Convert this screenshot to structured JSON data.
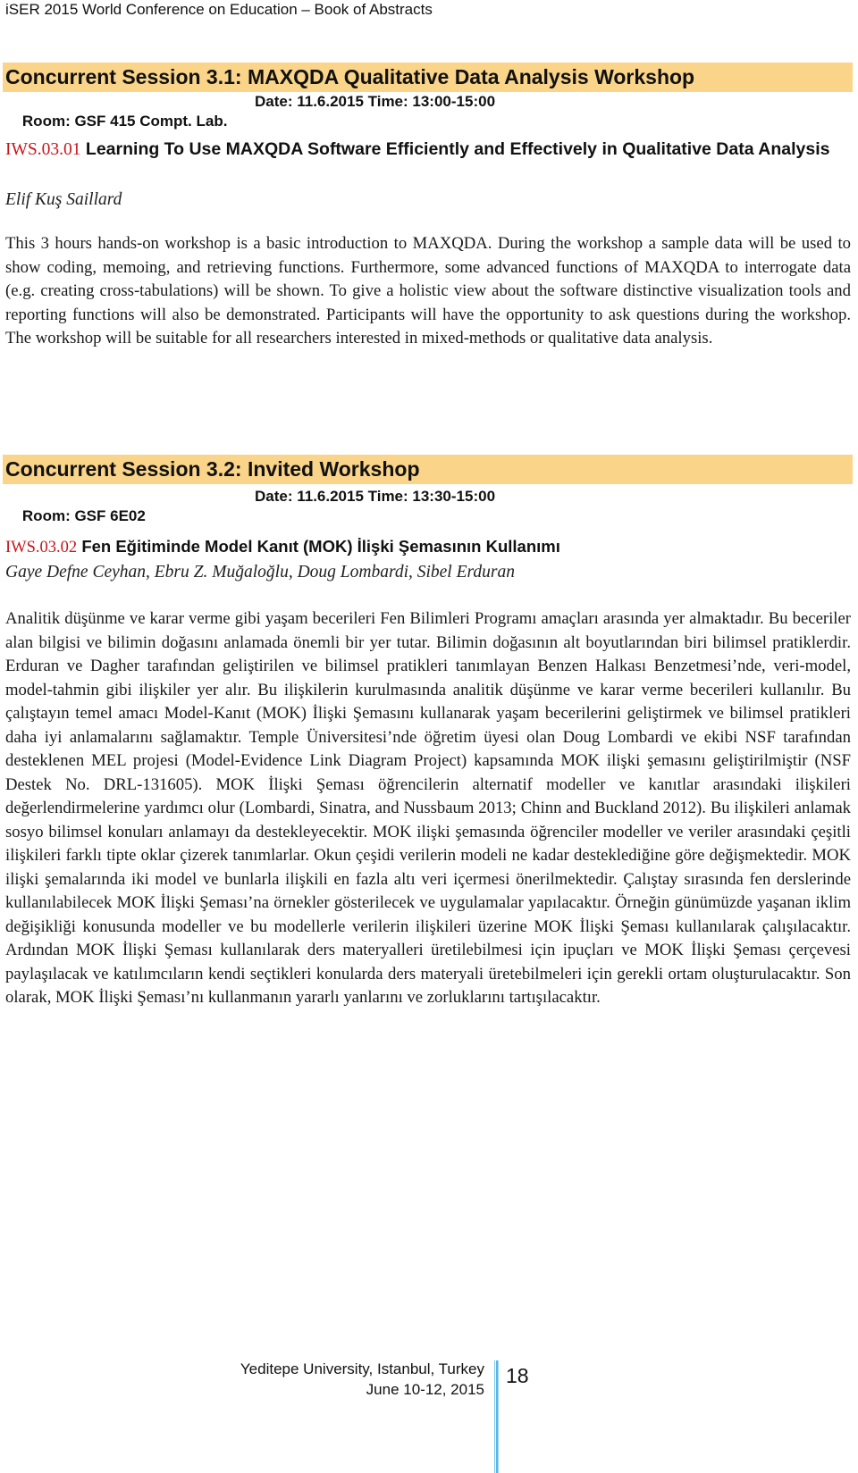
{
  "running_header": "iSER 2015 World Conference on Education – Book of Abstracts",
  "sessions": [
    {
      "title": "Concurrent Session 3.1: MAXQDA Qualitative Data Analysis Workshop",
      "room": "Room: GSF 415 Compt. Lab.",
      "date_time": "Date: 11.6.2015  Time: 13:00-15:00",
      "abstract": {
        "id": "IWS.03.01",
        "title": "Learning To Use MAXQDA Software Efficiently and Effectively in Qualitative Data Analysis",
        "authors": "Elif Kuş Saillard",
        "body": "This 3 hours hands-on workshop is a basic introduction to MAXQDA. During the workshop a sample data will be used to show coding, memoing, and retrieving functions. Furthermore, some advanced functions of MAXQDA to interrogate data (e.g. creating cross-tabulations) will be shown. To give a holistic view about the software distinctive visualization tools and reporting functions will also be demonstrated. Participants will have the opportunity to ask questions during the workshop. The workshop will be suitable for all researchers interested in mixed-methods or qualitative data analysis."
      }
    },
    {
      "title": "Concurrent Session 3.2: Invited Workshop",
      "room": "Room: GSF 6E02",
      "date_time": "Date: 11.6.2015  Time: 13:30-15:00",
      "abstract": {
        "id": "IWS.03.02",
        "title": "Fen Eğitiminde Model Kanıt (MOK) İlişki Şemasının Kullanımı",
        "authors": "Gaye Defne Ceyhan, Ebru Z. Muğaloğlu, Doug Lombardi, Sibel Erduran",
        "body": "Analitik düşünme ve karar verme gibi yaşam becerileri Fen Bilimleri Programı amaçları arasında yer almaktadır. Bu beceriler alan bilgisi ve bilimin doğasını anlamada önemli bir yer tutar. Bilimin doğasının alt boyutlarından biri bilimsel pratiklerdir. Erduran ve Dagher tarafından geliştirilen ve bilimsel pratikleri tanımlayan Benzen Halkası Benzetmesi’nde, veri-model, model-tahmin gibi ilişkiler yer alır. Bu ilişkilerin kurulmasında analitik düşünme ve karar verme becerileri kullanılır. Bu çalıştayın temel amacı Model-Kanıt (MOK) İlişki Şemasını kullanarak yaşam becerilerini geliştirmek ve bilimsel pratikleri daha iyi anlamalarını sağlamaktır. Temple Üniversitesi’nde öğretim üyesi olan Doug Lombardi ve ekibi NSF tarafından desteklenen MEL projesi (Model-Evidence Link Diagram Project) kapsamında MOK ilişki şemasını geliştirilmiştir (NSF Destek No. DRL-131605). MOK İlişki Şeması öğrencilerin alternatif modeller ve kanıtlar arasındaki ilişkileri değerlendirmelerine yardımcı olur (Lombardi, Sinatra, and Nussbaum 2013; Chinn and Buckland 2012). Bu ilişkileri anlamak sosyo bilimsel konuları anlamayı da destekleyecektir. MOK ilişki şemasında öğrenciler modeller ve veriler arasındaki çeşitli ilişkileri farklı tipte oklar çizerek tanımlarlar. Okun çeşidi verilerin modeli ne kadar desteklediğine göre değişmektedir. MOK ilişki şemalarında iki model ve bunlarla ilişkili en fazla altı veri içermesi önerilmektedir. Çalıştay sırasında fen derslerinde kullanılabilecek MOK İlişki Şeması’na örnekler gösterilecek ve uygulamalar yapılacaktır. Örneğin günümüzde yaşanan iklim değişikliği konusunda modeller ve bu modellerle verilerin ilişkileri üzerine MOK İlişki Şeması kullanılarak çalışılacaktır. Ardından MOK İlişki Şeması kullanılarak ders materyalleri üretilebilmesi için ipuçları ve MOK İlişki Şeması çerçevesi paylaşılacak ve katılımcıların kendi seçtikleri konularda ders materyali üretebilmeleri için gerekli ortam oluşturulacaktır. Son olarak, MOK İlişki Şeması’nı kullanmanın yararlı yanlarını ve zorluklarını tartışılacaktır."
      }
    }
  ],
  "footer": {
    "venue": "Yeditepe University, Istanbul, Turkey",
    "dates": "June 10-12, 2015",
    "page_number": "18"
  },
  "colors": {
    "session_band": "#f9d489",
    "abstract_id": "#c8151b",
    "footer_rule": "#5bb5e2"
  }
}
